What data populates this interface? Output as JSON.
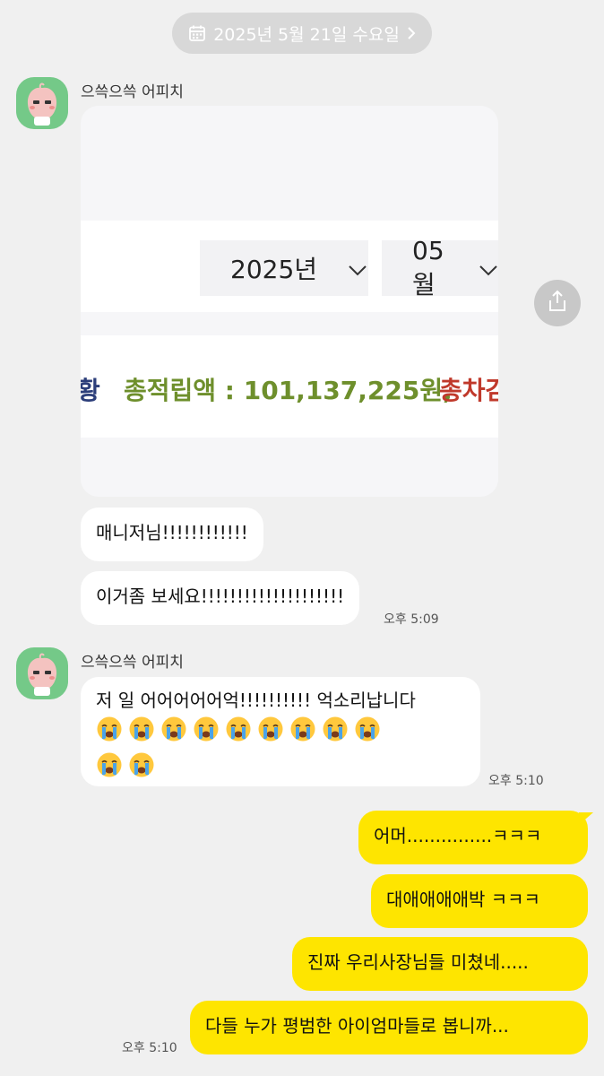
{
  "date_divider": {
    "label": "2025년 5월 21일 수요일"
  },
  "sender_name": "으쓱으쓱 어피치",
  "image_card": {
    "year_select": "2025년",
    "month_select": "05월",
    "left_fragment": "황",
    "total_text": "총적립액 : 101,137,225원,",
    "right_fragment": "총차감"
  },
  "messages": {
    "m1": "매니저님!!!!!!!!!!!!",
    "m2": "이거좀 보세요!!!!!!!!!!!!!!!!!!!!",
    "m2_time": "오후 5:09",
    "m3_text": "저 일 어어어어어억!!!!!!!!!! 억소리납니다",
    "m3_time": "오후 5:10",
    "crying_emoji_count": 11,
    "r1": "어머...............ㅋㅋㅋ",
    "r2": "대애애애애박 ㅋㅋㅋ",
    "r3": "진짜 우리사장님들 미쳤네.....",
    "r4": "다들 누가 평범한 아이엄마들로 봅니까...",
    "r4_time": "오후 5:10"
  },
  "colors": {
    "background": "#f0f0f0",
    "my_bubble": "#fee500",
    "other_bubble": "#ffffff",
    "avatar_bg": "#74c988",
    "total_green": "#6e8f2c",
    "fragment_red": "#c0392b",
    "fragment_navy": "#2c3e7a"
  },
  "icons": [
    "calendar-icon",
    "chevron-right-icon",
    "chevron-down-icon",
    "share-icon",
    "apeach-avatar-icon",
    "crying-face-emoji"
  ]
}
